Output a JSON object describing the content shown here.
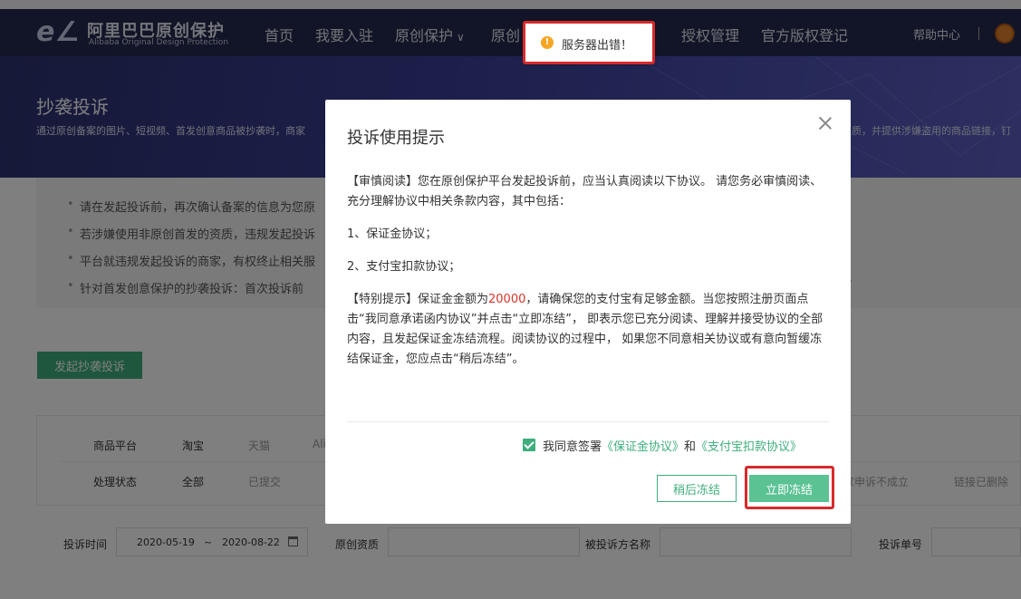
{
  "nav": {
    "logo_cn": "阿里巴巴原创保护",
    "logo_en": "Alibaba Original Design Protection",
    "items": [
      "首页",
      "我要入驻",
      "原创保护",
      "原创",
      "授权管理",
      "官方版权登记"
    ],
    "help": "帮助中心"
  },
  "banner": {
    "title": "抄袭投诉",
    "desc": "通过原创备案的图片、短视频、首发创意商品被抄袭时，商家",
    "desc_right": "质，并提供涉嫌盗用的商品链接，钉"
  },
  "tips": {
    "items": [
      "请在发起投诉前，再次确认备案的信息为您原",
      "若涉嫌使用非原创首发的资质，违规发起投诉",
      "平台就违规发起投诉的商家，有权终止相关服",
      "针对首发创意保护的抄袭投诉：首次投诉前"
    ],
    "link_tail": "”"
  },
  "start_button": "发起抄袭投诉",
  "filters": {
    "platform_label": "商品平台",
    "platform_options": [
      "淘宝",
      "天猫",
      "Ali"
    ],
    "status_label": "处理状态",
    "status_options": [
      "全部",
      "已提交"
    ],
    "status_right": [
      "家申诉不成立",
      "链接已删除"
    ]
  },
  "search": {
    "time_label": "投诉时间",
    "date_from": "2020-05-19",
    "date_sep": "~",
    "date_to": "2020-08-22",
    "qual_label": "原创资质",
    "party_label": "被投诉方名称",
    "no_label": "投诉单号"
  },
  "modal": {
    "title": "投诉使用提示",
    "p1": "【审慎阅读】您在原创保护平台发起投诉前，应当认真阅读以下协议。 请您务必审慎阅读、充分理解协议中相关条款内容，其中包括：",
    "p2": "1、保证金协议；",
    "p3": "2、支付宝扣款协议；",
    "p4_pre": "【特别提示】保证金金额为",
    "p4_amount": "20000",
    "p4_post": "，请确保您的支付宝有足够金额。当您按照注册页面点击“我同意承诺函内协议”并点击“立即冻结”， 即表示您已充分阅读、理解并接受协议的全部内容，且发起保证金冻结流程。阅读协议的过程中， 如果您不同意相关协议或有意向暂缓冻结保证金，您应点击“稍后冻结”。",
    "agree_pre": "我同意签署",
    "agree_link1": "《保证金协议》",
    "agree_and": "和",
    "agree_link2": "《支付宝扣款协议》",
    "btn_later": "稍后冻结",
    "btn_now": "立即冻结"
  },
  "toast": {
    "icon": "!",
    "text": "服务器出错！"
  },
  "colors": {
    "nav_bg": "#252a4e",
    "primary_green": "#3fae7c",
    "highlight_red": "#d62b2b",
    "amount_red": "#d9342a"
  }
}
